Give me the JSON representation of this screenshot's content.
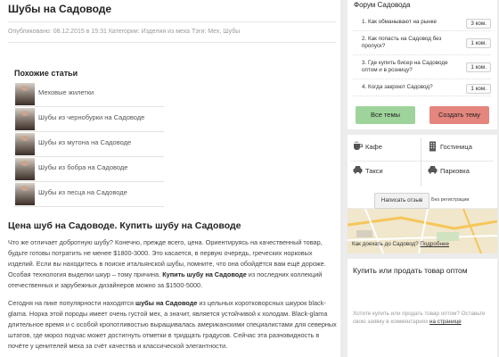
{
  "article": {
    "title": "Шубы на Садоводе",
    "meta_prefix": "Опубликовано: 08.12.2015 в 15:31 Категории: ",
    "meta_category": "Изделия из меха",
    "meta_tags_label": " Тэги: ",
    "meta_tag1": "Мех",
    "meta_sep": ", ",
    "meta_tag2": "Шубы"
  },
  "related": {
    "title": "Похожие статьи",
    "items": [
      {
        "label": "Меховые жилетки"
      },
      {
        "label": "Шубы из чернобурки на Садоводе"
      },
      {
        "label": "Шубы из мутона на Садоводе"
      },
      {
        "label": "Шубы из бобра на Садоводе"
      },
      {
        "label": "Шубы из песца на Садоводе"
      }
    ]
  },
  "content": {
    "heading": "Цена шуб на Садоводе. Купить шубу на Садоводе",
    "p1_a": "Что же отличает добротную шубу? Конечно, прежде всего, цена. Ориентируясь на качественный товар, будьте готовы потратить не менее $1800-3000. Это касается, в первую очередь, греческих норковых изделий. Если вы находитесь в поиске итальянской шубы, помните, что она обойдётся вам ещё дороже. Особая технология выделки шкур – тому причина. ",
    "p1_b": "Купить шубу на Садоводе",
    "p1_c": " из последних коллекций отечественных и зарубежных дизайнеров можно за $1500-5000.",
    "p2_a": "Сегодня на пике популярности находятся ",
    "p2_b": "шубы на Садоводе",
    "p2_c": " из цельных коротковорсных шкурок black-glama. Норка этой породы имеет очень густой мех, а значит, является устойчивой к холодам. Black-glama длительное время и с особой кропотливостью выращивалась американскими специалистами для северных штатов, где мороз подчас может достигнуть отметки в тридцать градусов.  Сейчас эта разновидность в почёте у ценителей меха за счёт качества и классической элегантности."
  },
  "forum": {
    "title": "Форум Садовода",
    "items": [
      {
        "q": "1. Как обманывают на рынке",
        "count": "3 ком."
      },
      {
        "q": "2. Как попасть на Садовод без пропуск?",
        "count": "1 ком."
      },
      {
        "q": "3. Где купить бисер на Садоводе оптом и в розницу?",
        "count": "1 ком."
      },
      {
        "q": "4. Когда закроют Садовод?",
        "count": "1 ком."
      }
    ],
    "btn_all": "Все темы",
    "btn_create": "Создать тему"
  },
  "services": {
    "cafe": "Кафе",
    "hotel": "Гостиница",
    "taxi": "Такси",
    "parking": "Парковка",
    "review_btn": "Написать отзыв",
    "review_note": "Без регистрации"
  },
  "map": {
    "question": "Как доехать до Садовод? ",
    "link": "Подробнее"
  },
  "buy": {
    "title": "Купить или продать товар оптом",
    "text": "Хотите купить или продать товар оптом? Оставьте свою заявку в комментариях ",
    "link": "на странице"
  }
}
